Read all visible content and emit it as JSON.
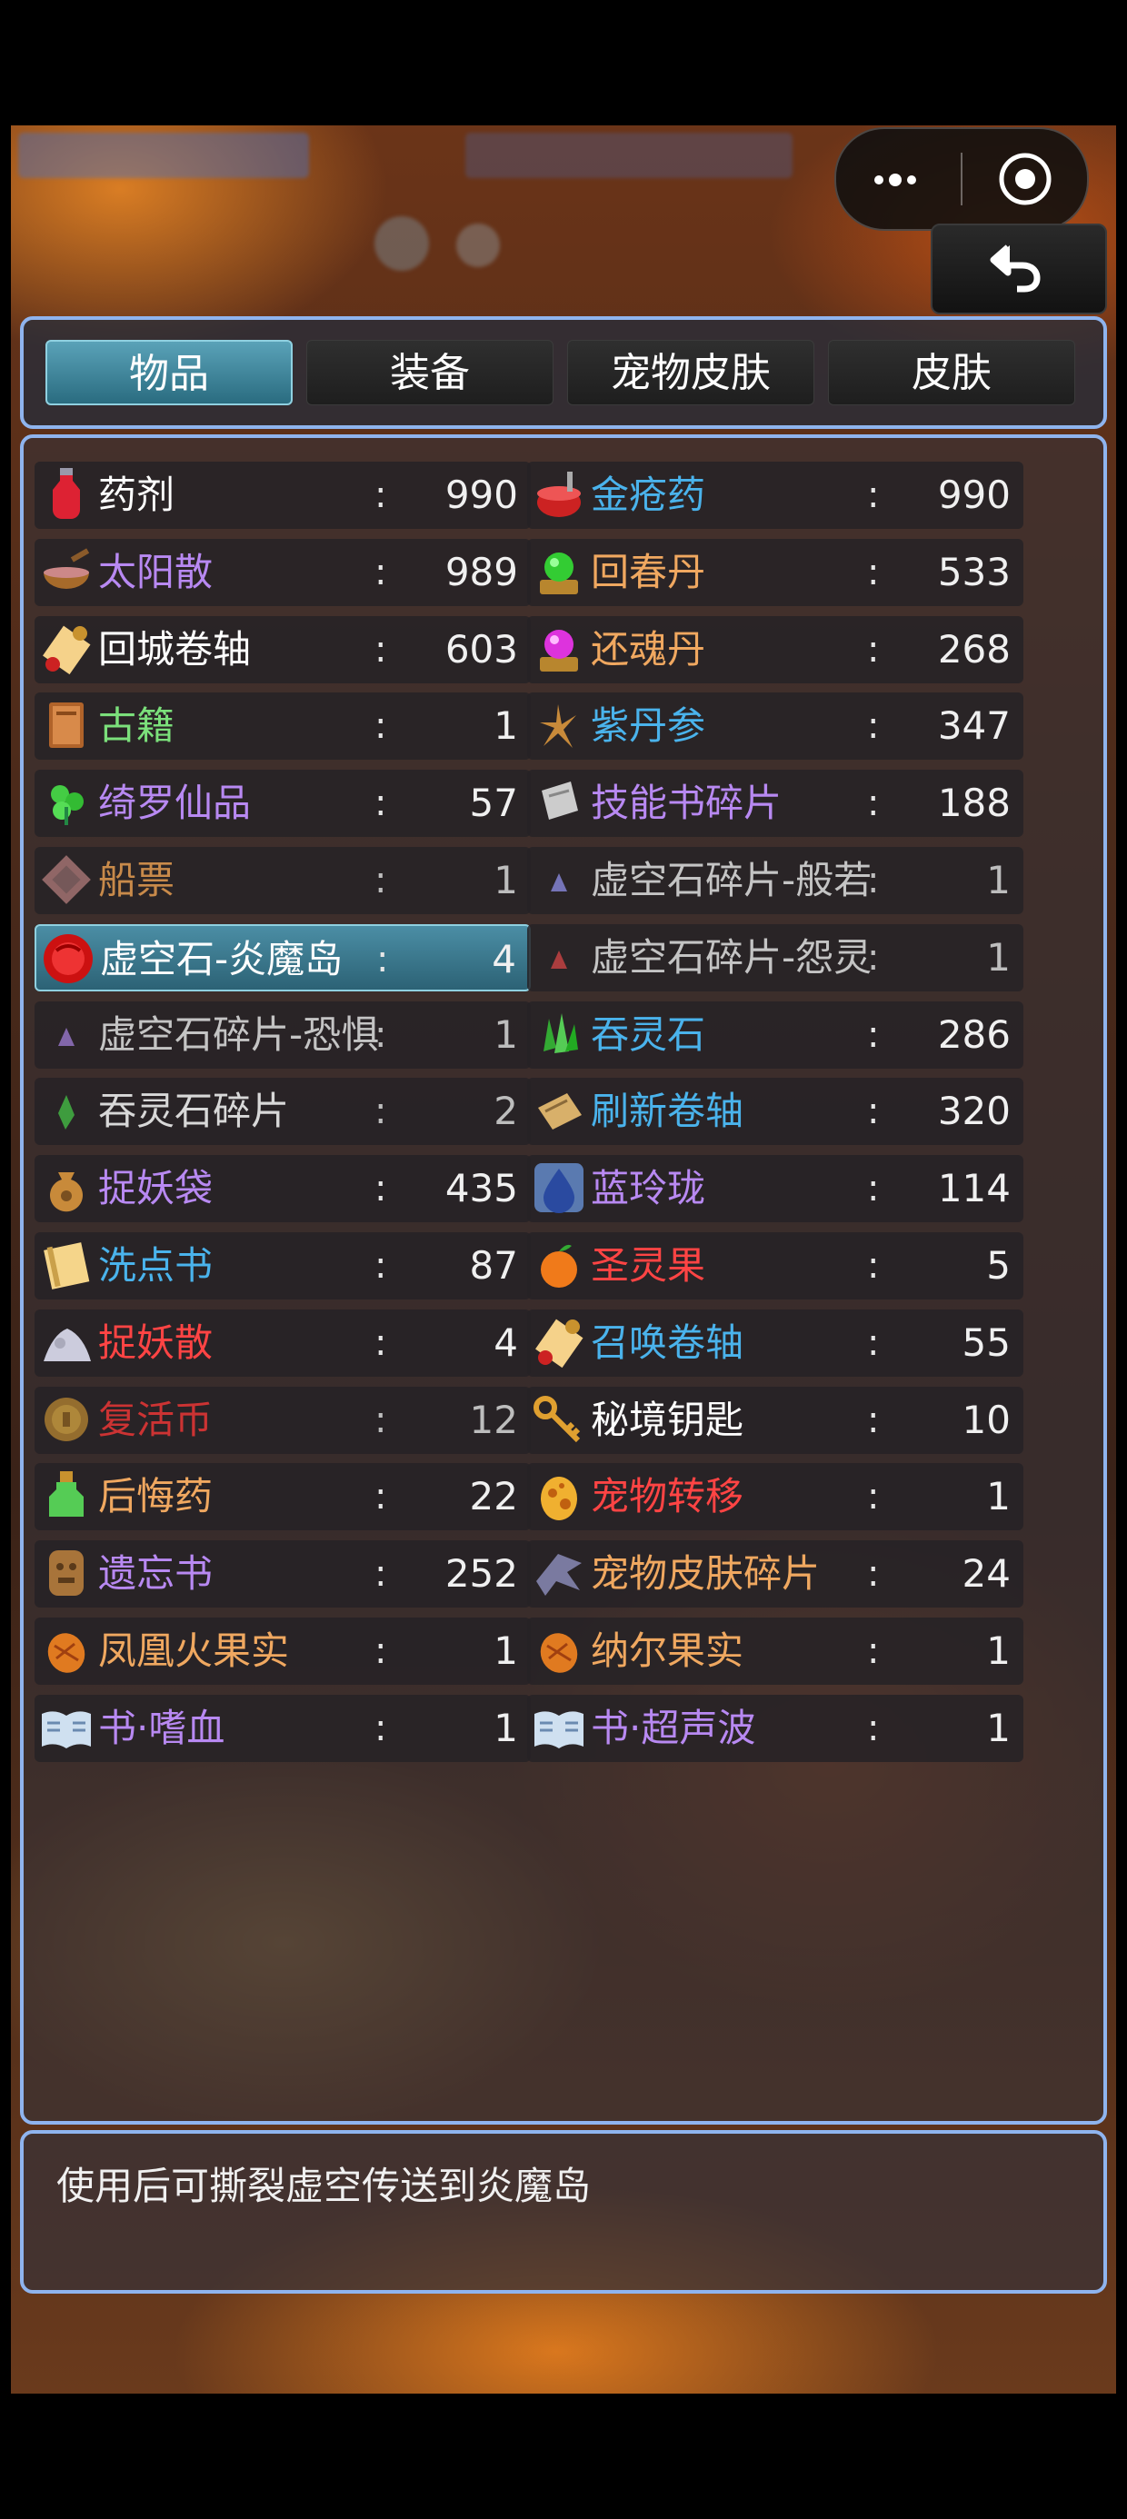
{
  "tabs": [
    {
      "label": "物品",
      "active": true
    },
    {
      "label": "装备",
      "active": false
    },
    {
      "label": "宠物皮肤",
      "active": false
    },
    {
      "label": "皮肤",
      "active": false
    }
  ],
  "separator": ":",
  "items": [
    {
      "name": "药剂",
      "count": "990",
      "color": "#ffffff",
      "icon": "potion-icon"
    },
    {
      "name": "金疮药",
      "count": "990",
      "color": "#4ab3ec",
      "icon": "medicine-bowl-icon"
    },
    {
      "name": "太阳散",
      "count": "989",
      "color": "#b889f2",
      "icon": "herb-bowl-icon"
    },
    {
      "name": "回春丹",
      "count": "533",
      "color": "#f0a860",
      "icon": "green-orb-icon"
    },
    {
      "name": "回城卷轴",
      "count": "603",
      "color": "#ffffff",
      "icon": "scroll-icon"
    },
    {
      "name": "还魂丹",
      "count": "268",
      "color": "#f0a860",
      "icon": "pink-orb-icon"
    },
    {
      "name": "古籍",
      "count": "1",
      "color": "#7be07b",
      "icon": "ancient-book-icon"
    },
    {
      "name": "紫丹参",
      "count": "347",
      "color": "#4ab3ec",
      "icon": "ginseng-root-icon"
    },
    {
      "name": "绮罗仙品",
      "count": "57",
      "color": "#b889f2",
      "icon": "green-herb-icon"
    },
    {
      "name": "技能书碎片",
      "count": "188",
      "color": "#b889f2",
      "icon": "page-fragment-icon"
    },
    {
      "name": "船票",
      "count": "1",
      "color": "#c88a4a",
      "icon": "ticket-icon"
    },
    {
      "name": "虚空石碎片-般若",
      "count": "1",
      "color": "#c4c4c4",
      "icon": "purple-shard-icon"
    },
    {
      "name": "虚空石-炎魔岛",
      "count": "4",
      "color": "#ffffff",
      "icon": "red-stone-icon",
      "selected": true
    },
    {
      "name": "虚空石碎片-怨灵",
      "count": "1",
      "color": "#c4c4c4",
      "icon": "red-shard-icon"
    },
    {
      "name": "虚空石碎片-恐惧",
      "count": "1",
      "color": "#c4c4c4",
      "icon": "violet-shard-icon"
    },
    {
      "name": "吞灵石",
      "count": "286",
      "color": "#4ab3ec",
      "icon": "green-crystal-icon"
    },
    {
      "name": "吞灵石碎片",
      "count": "2",
      "color": "#d8d8d8",
      "icon": "green-shard-icon"
    },
    {
      "name": "刷新卷轴",
      "count": "320",
      "color": "#4ab3ec",
      "icon": "open-scroll-icon"
    },
    {
      "name": "捉妖袋",
      "count": "435",
      "color": "#b889f2",
      "icon": "money-bag-icon"
    },
    {
      "name": "蓝玲珑",
      "count": "114",
      "color": "#b889f2",
      "icon": "blue-drop-icon"
    },
    {
      "name": "洗点书",
      "count": "87",
      "color": "#4ab3ec",
      "icon": "yellow-book-icon"
    },
    {
      "name": "圣灵果",
      "count": "5",
      "color": "#ff4444",
      "icon": "orange-fruit-icon"
    },
    {
      "name": "捉妖散",
      "count": "4",
      "color": "#ff4444",
      "icon": "powder-pile-icon"
    },
    {
      "name": "召唤卷轴",
      "count": "55",
      "color": "#4ab3ec",
      "icon": "summon-scroll-icon"
    },
    {
      "name": "复活币",
      "count": "12",
      "color": "#cc3333",
      "icon": "coin-icon"
    },
    {
      "name": "秘境钥匙",
      "count": "10",
      "color": "#ffffff",
      "icon": "key-icon"
    },
    {
      "name": "后悔药",
      "count": "22",
      "color": "#f0a860",
      "icon": "green-potion-icon"
    },
    {
      "name": "宠物转移",
      "count": "1",
      "color": "#ff4444",
      "icon": "spotted-egg-icon"
    },
    {
      "name": "遗忘书",
      "count": "252",
      "color": "#b889f2",
      "icon": "carved-tablet-icon"
    },
    {
      "name": "宠物皮肤碎片",
      "count": "24",
      "color": "#f0a860",
      "icon": "dragon-shard-icon"
    },
    {
      "name": "凤凰火果实",
      "count": "1",
      "color": "#f0a860",
      "icon": "phoenix-fruit-icon"
    },
    {
      "name": "纳尔果实",
      "count": "1",
      "color": "#f0a860",
      "icon": "nar-fruit-icon"
    },
    {
      "name": "书·嗜血",
      "count": "1",
      "color": "#b889f2",
      "icon": "open-book-icon"
    },
    {
      "name": "书·超声波",
      "count": "1",
      "color": "#b889f2",
      "icon": "open-book-icon"
    }
  ],
  "description": "使用后可撕裂虚空传送到炎魔岛"
}
